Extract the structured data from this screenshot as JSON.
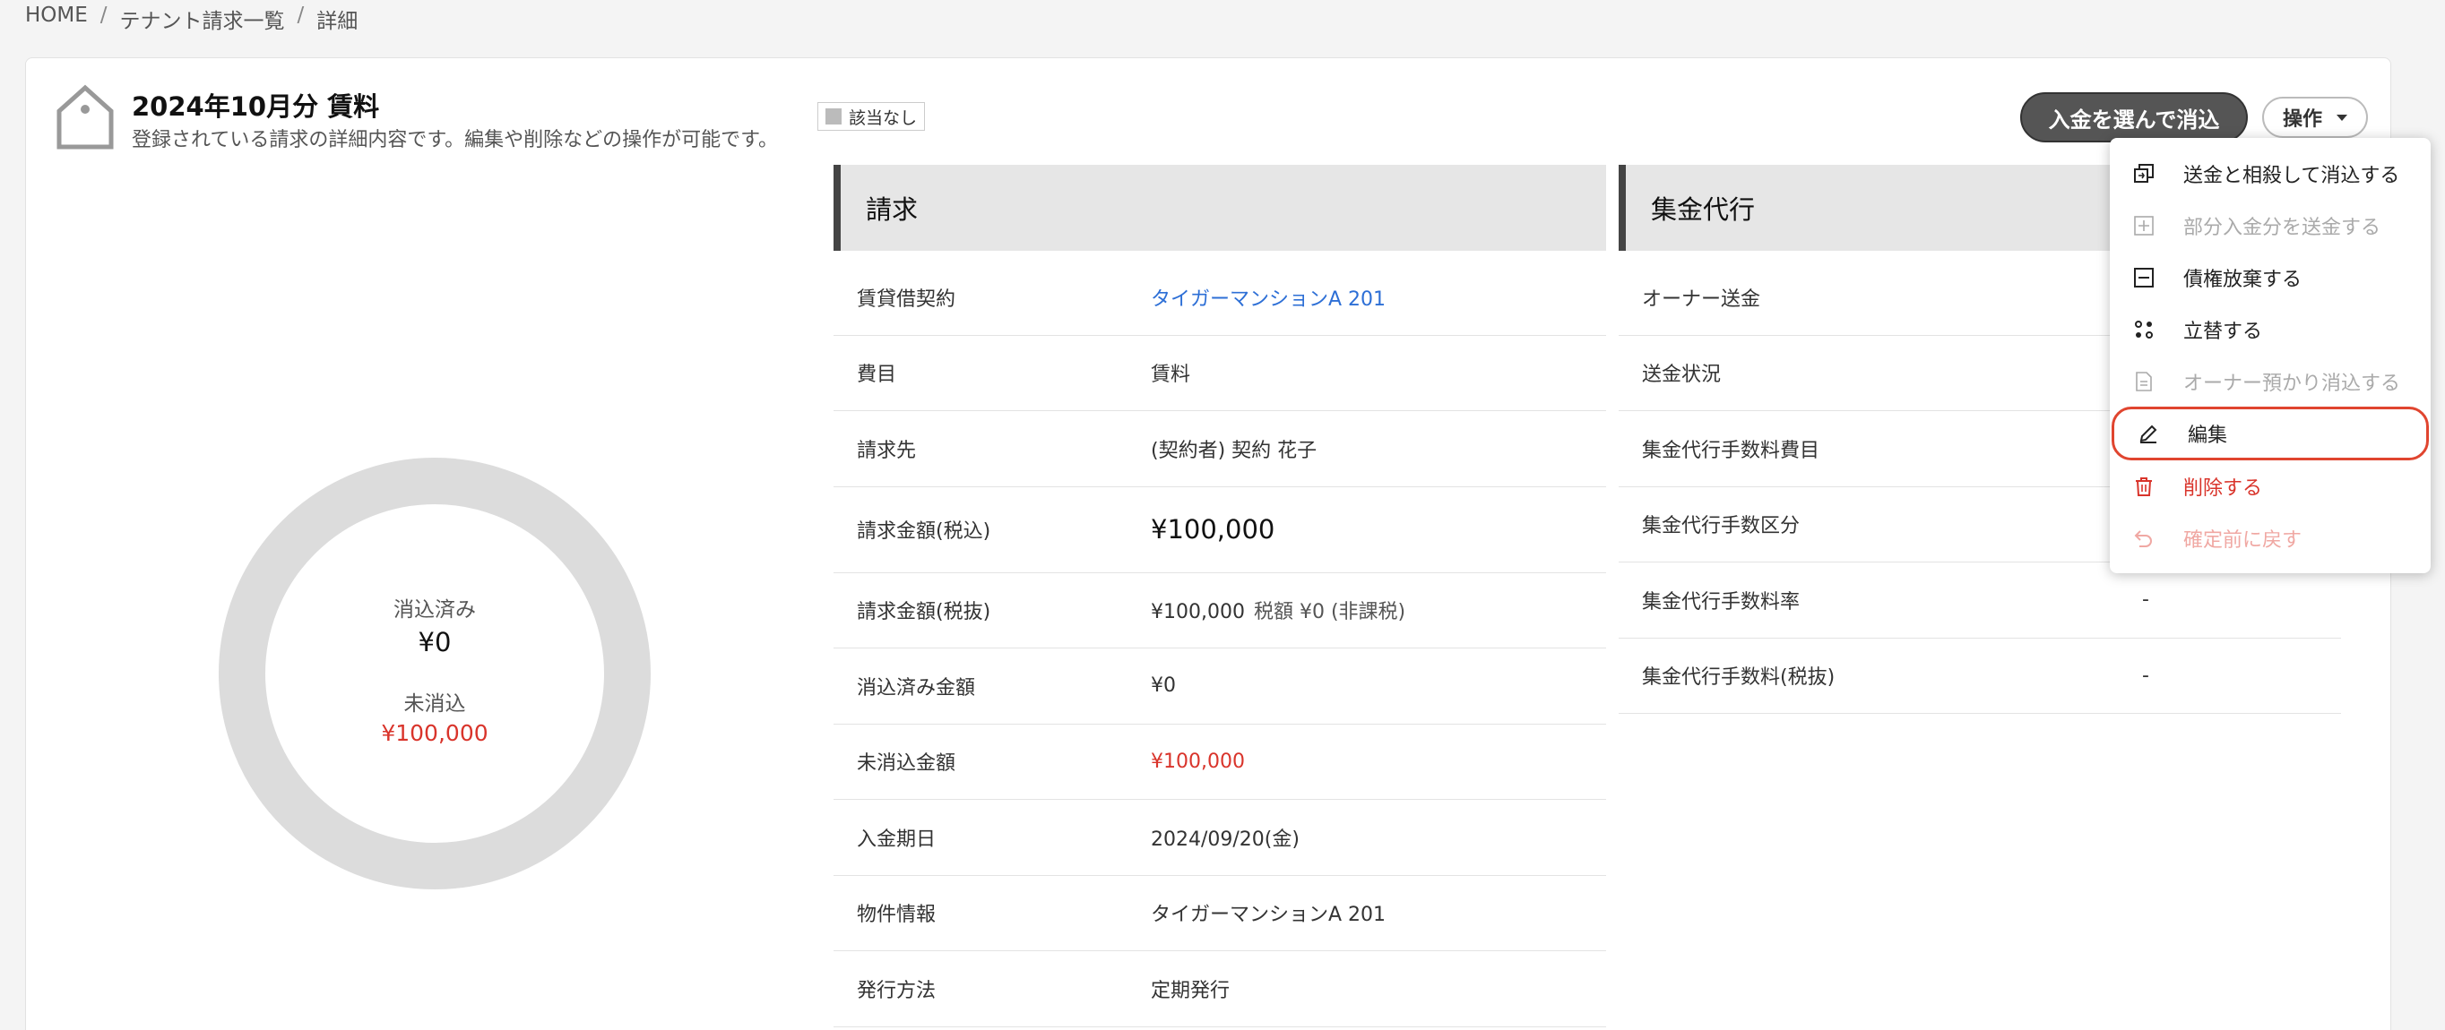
{
  "breadcrumb": {
    "home": "HOME",
    "sep": "/",
    "list": "テナント請求一覧",
    "current": "詳細"
  },
  "header": {
    "title": "2024年10月分 賃料",
    "subtitle": "登録されている請求の詳細内容です。編集や削除などの操作が可能です。",
    "badge": "該当なし",
    "primary_button": "入金を選んで消込",
    "ops_button": "操作"
  },
  "donut": {
    "reconciled_label": "消込済み",
    "reconciled_value": "¥0",
    "unreconciled_label": "未消込",
    "unreconciled_value": "¥100,000"
  },
  "billing": {
    "heading": "請求",
    "rows": [
      {
        "label": "賃貸借契約",
        "value": "タイガーマンションA 201"
      },
      {
        "label": "費目",
        "value": "賃料"
      },
      {
        "label": "請求先",
        "value": "(契約者) 契約 花子"
      },
      {
        "label": "請求金額(税込)",
        "value": "¥100,000"
      },
      {
        "label": "請求金額(税抜)",
        "value": "¥100,000",
        "extra": "税額 ¥0 (非課税)"
      },
      {
        "label": "消込済み金額",
        "value": "¥0"
      },
      {
        "label": "未消込金額",
        "value": "¥100,000"
      },
      {
        "label": "入金期日",
        "value": "2024/09/20(金)"
      },
      {
        "label": "物件情報",
        "value": "タイガーマンションA 201"
      },
      {
        "label": "発行方法",
        "value": "定期発行"
      }
    ]
  },
  "agency": {
    "heading": "集金代行",
    "rows": [
      {
        "label": "オーナー送金",
        "value": ""
      },
      {
        "label": "送金状況",
        "value": ""
      },
      {
        "label": "集金代行手数料費目",
        "value": ""
      },
      {
        "label": "集金代行手数区分",
        "value": ""
      },
      {
        "label": "集金代行手数料率",
        "value": "-"
      },
      {
        "label": "集金代行手数料(税抜)",
        "value": "-"
      }
    ]
  },
  "menu": {
    "items": [
      {
        "label": "送金と相殺して消込する",
        "icon": "offset-icon",
        "state": "enabled"
      },
      {
        "label": "部分入金分を送金する",
        "icon": "plus-box-icon",
        "state": "disabled"
      },
      {
        "label": "債権放棄する",
        "icon": "minus-box-icon",
        "state": "enabled"
      },
      {
        "label": "立替する",
        "icon": "advance-icon",
        "state": "enabled"
      },
      {
        "label": "オーナー預かり消込する",
        "icon": "document-icon",
        "state": "disabled"
      },
      {
        "label": "編集",
        "icon": "pencil-icon",
        "state": "highlighted"
      },
      {
        "label": "削除する",
        "icon": "trash-icon",
        "state": "danger"
      },
      {
        "label": "確定前に戻す",
        "icon": "undo-icon",
        "state": "danger-disabled"
      }
    ]
  },
  "colors": {
    "accent_red": "#d9342b",
    "link_blue": "#2d6fd6",
    "highlight_border": "#e0452f"
  }
}
